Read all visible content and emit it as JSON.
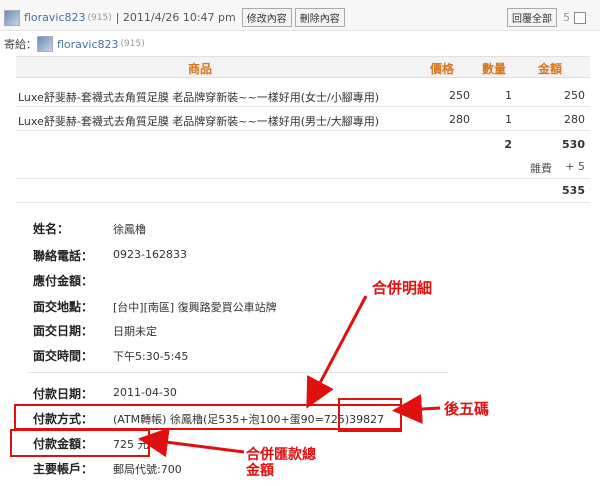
{
  "header": {
    "author": "floravic823",
    "author_score": "(915)",
    "datetime": "| 2011/4/26  10:47 pm",
    "edit_button": "修改內容",
    "delete_button": "刪除內容",
    "reply_all_button": "回覆全部",
    "reply_count": "5",
    "recipient_label": "寄給：",
    "recipient": "floravic823",
    "recipient_score": "(915)"
  },
  "table": {
    "columns": [
      "商品",
      "價格",
      "數量",
      "金額"
    ],
    "rows": [
      {
        "product": "Luxe舒斐赫-套襪式去角質足膜 老品牌穿新裝~~一樣好用(女士/小腳專用)",
        "price": "250",
        "qty": "1",
        "amount": "250"
      },
      {
        "product": "Luxe舒斐赫-套襪式去角質足膜 老品牌穿新裝~~一樣好用(男士/大腳專用)",
        "price": "280",
        "qty": "1",
        "amount": "280"
      }
    ],
    "total_qty": "2",
    "subtotal": "530",
    "misc_label": "雜費",
    "misc_value": "+ 5",
    "grand_total": "535"
  },
  "info": {
    "name_label": "姓名：",
    "name": "徐鳳櫓",
    "phone_label": "聯絡電話：",
    "phone": "0923-162833",
    "due_label": "應付金額：",
    "due": "",
    "place_label": "面交地點：",
    "place": "[台中][南區] 復興路愛買公車站牌",
    "date_label": "面交日期：",
    "date": "日期未定",
    "time_label": "面交時間：",
    "time": "下午5:30-5:45",
    "paydate_label": "付款日期：",
    "paydate": "2011-04-30",
    "method_label": "付款方式：",
    "method": "(ATM轉帳) 徐鳳櫓(足535+泡100+蛋90=725)39827",
    "amount_label": "付款金額：",
    "amount": "725 元",
    "account_label": "主要帳戶：",
    "account": "郵局代號:700"
  },
  "annotations": {
    "merge_detail": "合併明細",
    "last_five": "後五碼",
    "merge_total_line1": "合併匯款總",
    "merge_total_line2": "金額"
  },
  "colors": {
    "annotation": "#e01010",
    "header_accent": "#d9751b",
    "link": "#4a6fa5"
  }
}
